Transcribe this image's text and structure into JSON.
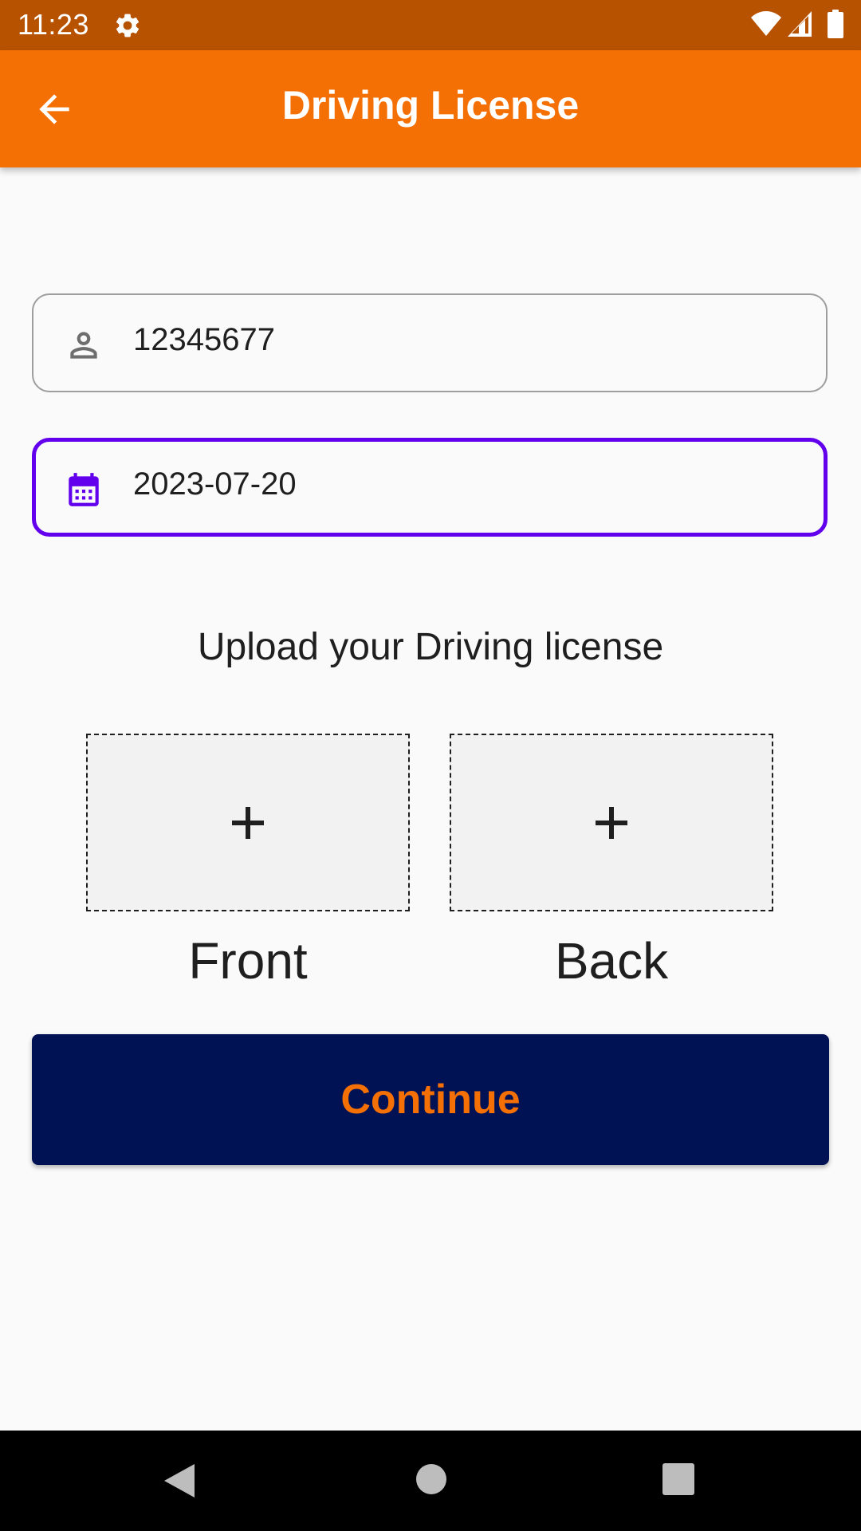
{
  "status_bar": {
    "time": "11:23",
    "icons": [
      "gear-icon",
      "wifi-icon",
      "signal-icon",
      "battery-icon"
    ]
  },
  "app_bar": {
    "title": "Driving License",
    "back_icon": "arrow-left-icon",
    "color": "#f57004"
  },
  "form": {
    "license_number": {
      "icon": "person-icon",
      "value": "12345677"
    },
    "date": {
      "icon": "calendar-icon",
      "value": "2023-07-20",
      "focused": true,
      "accent_color": "#6200ee"
    }
  },
  "upload": {
    "title": "Upload your Driving license",
    "front": {
      "symbol": "+",
      "label": "Front"
    },
    "back": {
      "symbol": "+",
      "label": "Back"
    }
  },
  "continue_button": {
    "label": "Continue",
    "background": "#001154",
    "text_color": "#f57004"
  },
  "nav_bar": {
    "icons": [
      "nav-back-icon",
      "nav-home-icon",
      "nav-recents-icon"
    ]
  }
}
